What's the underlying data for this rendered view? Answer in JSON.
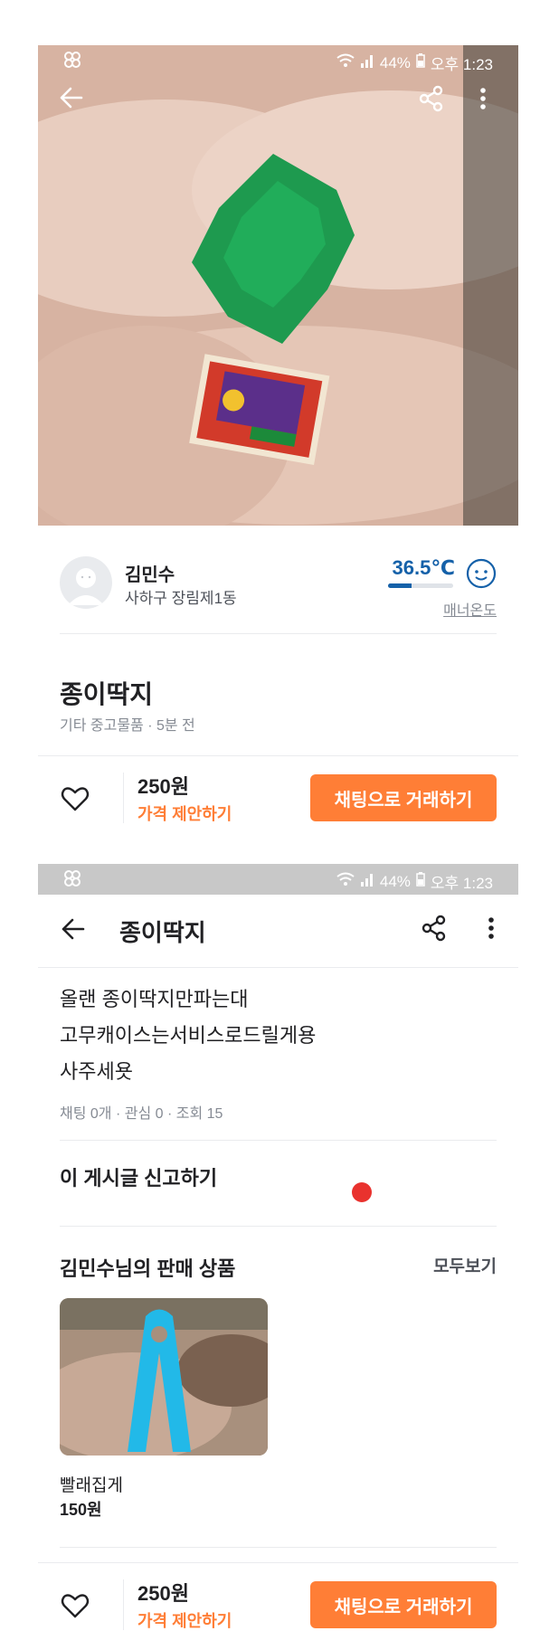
{
  "status_bar": {
    "battery": "44%",
    "time": "오후 1:23"
  },
  "seller": {
    "name": "김민수",
    "region": "사하구 장림제1동",
    "temperature": "36.5℃",
    "temperature_ratio": 0.365,
    "manner_label": "매너온도"
  },
  "product": {
    "title": "종이딱지",
    "category_time": "기타 중고물품 · 5분 전",
    "description_lines": [
      "올랜 종이딱지만파는대",
      "고무캐이스는서비스로드릴게용",
      "사주세욧"
    ],
    "stats": "채팅 0개 · 관심 0 · 조회 15"
  },
  "bottom_bar": {
    "price": "250원",
    "offer_label": "가격 제안하기",
    "chat_button": "채팅으로 거래하기"
  },
  "report_label": "이 게시글 신고하기",
  "seller_items": {
    "title": "김민수님의 판매 상품",
    "see_all": "모두보기",
    "items": [
      {
        "name": "빨래집게",
        "price": "150원"
      }
    ]
  },
  "colors": {
    "accent": "#ff7e36",
    "temperature": "#1561a9",
    "marker": "#e9322e"
  },
  "icons": [
    "back-icon",
    "share-icon",
    "more-icon",
    "heart-icon",
    "wifi-icon",
    "signal-icon",
    "battery-icon",
    "app-status-icon",
    "smile-face-icon"
  ]
}
